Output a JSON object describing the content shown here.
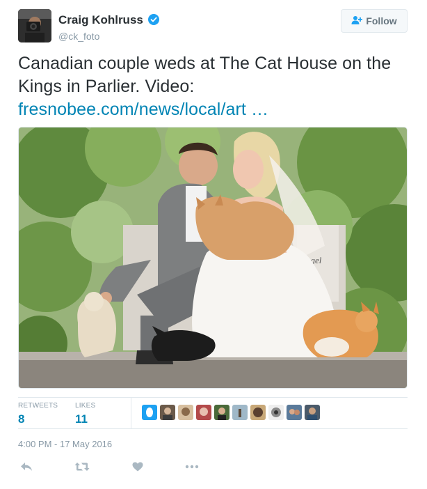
{
  "user": {
    "display_name": "Craig Kohlruss",
    "handle": "@ck_foto",
    "follow_label": "Follow"
  },
  "tweet": {
    "text": "Canadian couple weds at The Cat House on the Kings in Parlier. Video:",
    "link": "fresnobee.com/news/local/art …",
    "timestamp": "4:00 PM - 17 May 2016"
  },
  "stats": {
    "retweets_label": "RETWEETS",
    "retweets": "8",
    "likes_label": "LIKES",
    "likes": "11"
  },
  "colors": {
    "link": "#0084b4",
    "text": "#292f33",
    "muted": "#8899a6",
    "verified": "#1da1f2"
  },
  "icons": {
    "reply": "reply-icon",
    "retweet": "retweet-icon",
    "like": "heart-icon",
    "more": "more-icon"
  }
}
